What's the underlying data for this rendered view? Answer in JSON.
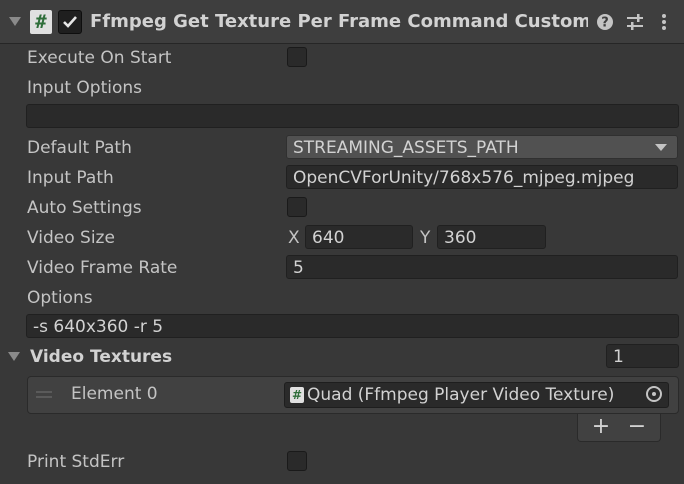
{
  "header": {
    "title": "Ffmpeg Get Texture Per Frame Command Custom (Script)",
    "script_icon_glyph": "#",
    "enabled": true,
    "icons": [
      "help-icon",
      "presets-icon",
      "kebab-menu-icon"
    ]
  },
  "fields": {
    "execute_on_start": {
      "label": "Execute On Start",
      "checked": false
    },
    "input_options": {
      "label": "Input Options",
      "value": ""
    },
    "default_path": {
      "label": "Default Path",
      "value": "STREAMING_ASSETS_PATH"
    },
    "input_path": {
      "label": "Input Path",
      "value": "OpenCVForUnity/768x576_mjpeg.mjpeg"
    },
    "auto_settings": {
      "label": "Auto Settings",
      "checked": false
    },
    "video_size": {
      "label": "Video Size",
      "x_label": "X",
      "x": "640",
      "y_label": "Y",
      "y": "360"
    },
    "video_frame_rate": {
      "label": "Video Frame Rate",
      "value": "5"
    },
    "options": {
      "label": "Options",
      "value": "-s 640x360 -r 5"
    }
  },
  "video_textures": {
    "label": "Video Textures",
    "size": "1",
    "elements": [
      {
        "label": "Element 0",
        "value": "Quad (Ffmpeg Player Video Texture)"
      }
    ],
    "add_label": "+",
    "remove_label": "−"
  },
  "print_stderr": {
    "label": "Print StdErr",
    "checked": false
  },
  "colors": {
    "background": "#383838",
    "header": "#3e3e3e",
    "field": "#2a2a2a",
    "dropdown": "#515151",
    "text": "#c4c4c4"
  }
}
